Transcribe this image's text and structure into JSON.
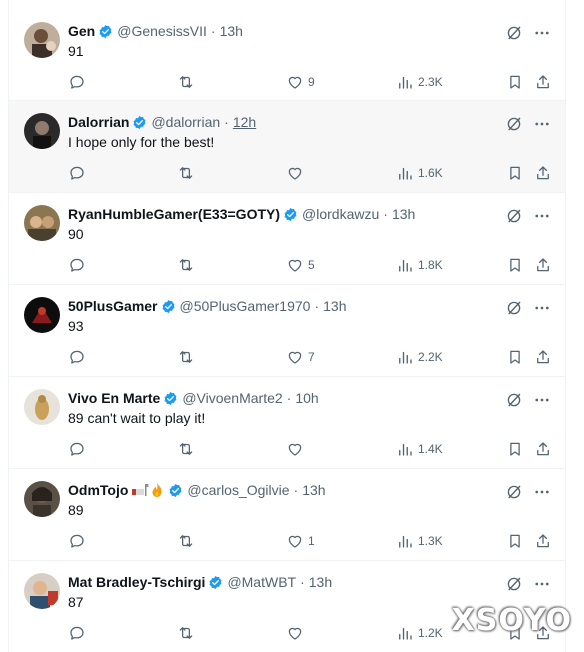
{
  "watermark": "XSOYO",
  "tweets": [
    {
      "name": "Gen",
      "handle": "@GenesissVII",
      "time": "13h",
      "text": "91",
      "replies": "",
      "retweets": "",
      "likes": "9",
      "views": "2.3K",
      "avatar": "portrait-man-beard"
    },
    {
      "name": "Dalorrian",
      "handle": "@dalorrian",
      "time": "12h",
      "text": "I hope only for the best!",
      "replies": "",
      "retweets": "",
      "likes": "",
      "views": "1.6K",
      "avatar": "portrait-man-dark"
    },
    {
      "name": "RyanHumbleGamer(E33=GOTY)",
      "handle": "@lordkawzu",
      "time": "13h",
      "text": "90",
      "replies": "",
      "retweets": "",
      "likes": "5",
      "views": "1.8K",
      "avatar": "portrait-two-people"
    },
    {
      "name": "50PlusGamer",
      "handle": "@50PlusGamer1970",
      "time": "13h",
      "text": "93",
      "replies": "",
      "retweets": "",
      "likes": "7",
      "views": "2.2K",
      "avatar": "dark-red-figure"
    },
    {
      "name": "Vivo En Marte",
      "handle": "@VivoenMarte2",
      "time": "10h",
      "text": "89 can't wait to play it!",
      "replies": "",
      "retweets": "",
      "likes": "",
      "views": "1.4K",
      "avatar": "gold-statue"
    },
    {
      "name": "OdmTojo",
      "handle": "@carlos_Ogilvie",
      "time": "13h",
      "text": "89",
      "replies": "",
      "retweets": "",
      "likes": "1",
      "views": "1.3K",
      "avatar": "portrait-dark-hair",
      "name_emojis": [
        "flag-icon",
        "fire-icon"
      ]
    },
    {
      "name": "Mat Bradley-Tschirgi",
      "handle": "@MatWBT",
      "time": "13h",
      "text": "87",
      "replies": "",
      "retweets": "",
      "likes": "",
      "views": "1.2K",
      "avatar": "portrait-man-smile"
    }
  ],
  "colors": {
    "verified": "#1d9bf0",
    "text_primary": "#0f1419",
    "text_secondary": "#536471",
    "border": "#eff3f4",
    "hover_bg": "#f7f7f7"
  },
  "icons": [
    "reply-icon",
    "retweet-icon",
    "like-icon",
    "views-icon",
    "bookmark-icon",
    "share-icon",
    "grok-icon",
    "more-icon",
    "verified-badge-icon"
  ]
}
